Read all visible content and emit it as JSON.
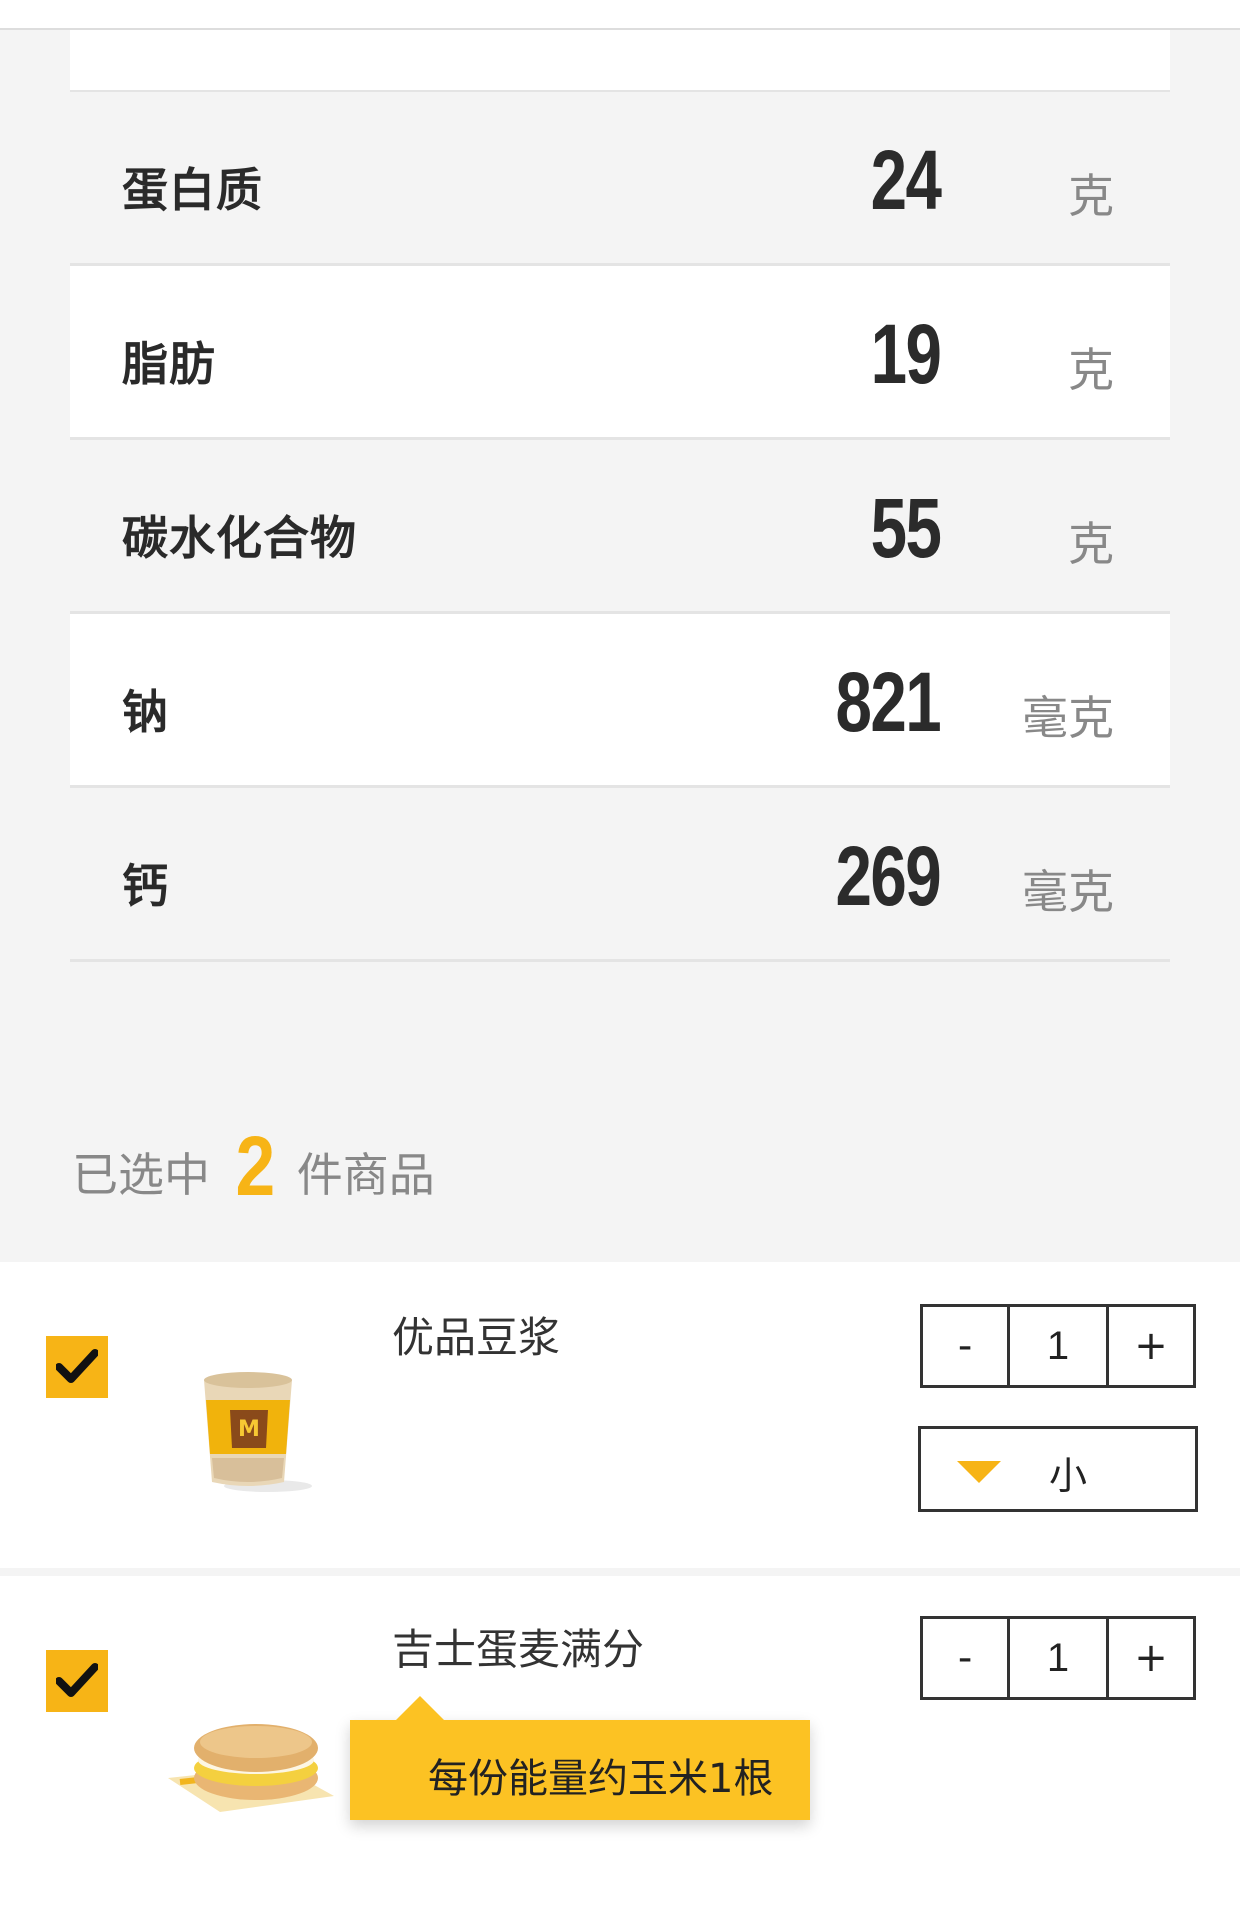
{
  "nutrition": [
    {
      "name": "蛋白质",
      "value": "24",
      "unit": "克"
    },
    {
      "name": "脂肪",
      "value": "19",
      "unit": "克"
    },
    {
      "name": "碳水化合物",
      "value": "55",
      "unit": "克"
    },
    {
      "name": "钠",
      "value": "821",
      "unit": "毫克"
    },
    {
      "name": "钙",
      "value": "269",
      "unit": "毫克"
    }
  ],
  "selection": {
    "prefix": "已选中",
    "count": "2",
    "suffix": "件商品"
  },
  "products": [
    {
      "name": "优品豆浆",
      "quantity": "1",
      "minus_label": "-",
      "plus_label": "+",
      "size": "小",
      "checked": true,
      "image_icon": "soy-milk-cup-icon"
    },
    {
      "name": "吉士蛋麦满分",
      "quantity": "1",
      "minus_label": "-",
      "plus_label": "+",
      "checked": true,
      "image_icon": "egg-muffin-icon",
      "tooltip": "每份能量约玉米1根"
    }
  ],
  "colors": {
    "accent": "#f7b416",
    "tooltip": "#fcc223",
    "text_dark": "#2a2a2a",
    "text_muted": "#888888"
  }
}
